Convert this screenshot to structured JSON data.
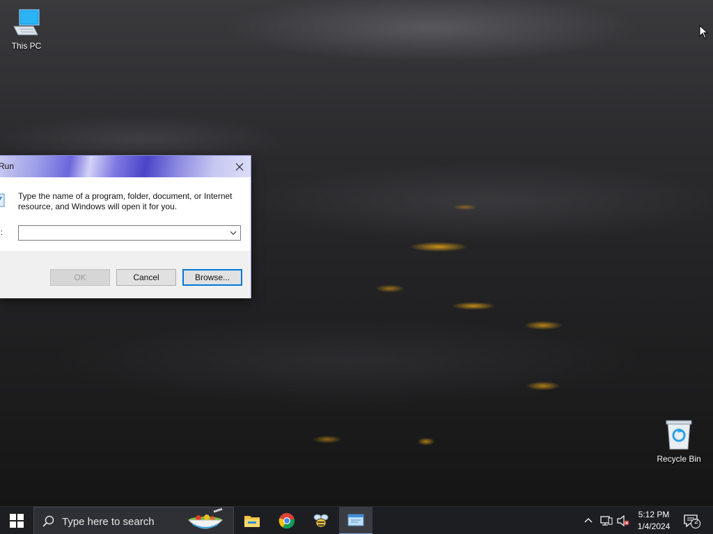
{
  "desktop": {
    "icons": [
      {
        "label": "This PC"
      },
      {
        "label": "Recycle Bin"
      }
    ]
  },
  "run_dialog": {
    "title": "Run",
    "description": "Type the name of a program, folder, document, or Internet resource, and Windows will open it for you.",
    "open_label": "n:",
    "open_value": "",
    "buttons": {
      "ok": "OK",
      "cancel": "Cancel",
      "browse": "Browse..."
    }
  },
  "taskbar": {
    "search_placeholder": "Type here to search",
    "pinned_apps": [
      "file-explorer",
      "google-chrome",
      "bee-app",
      "run"
    ],
    "active_app": "run",
    "notification_count": "2",
    "clock": {
      "time": "5:12 PM",
      "date": "1/4/2024"
    }
  }
}
